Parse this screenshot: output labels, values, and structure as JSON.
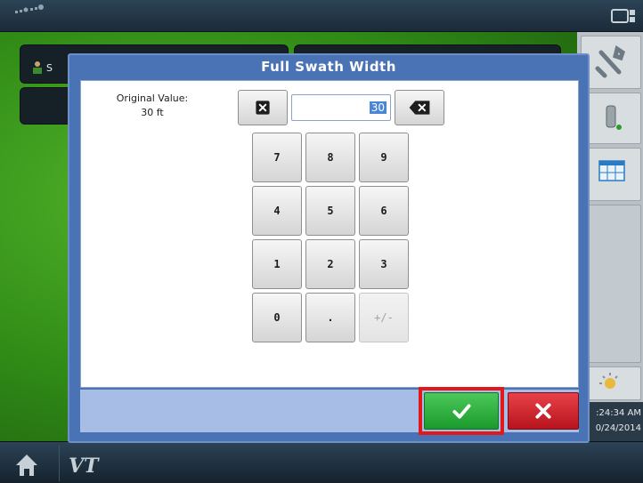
{
  "dialog": {
    "title": "Full Swath Width",
    "original_label": "Original Value:",
    "original_value": "30 ft",
    "input_value": "30",
    "keypad": [
      {
        "label": "7",
        "enabled": true
      },
      {
        "label": "8",
        "enabled": true
      },
      {
        "label": "9",
        "enabled": true
      },
      {
        "label": "4",
        "enabled": true
      },
      {
        "label": "5",
        "enabled": true
      },
      {
        "label": "6",
        "enabled": true
      },
      {
        "label": "1",
        "enabled": true
      },
      {
        "label": "2",
        "enabled": true
      },
      {
        "label": "3",
        "enabled": true
      },
      {
        "label": "0",
        "enabled": true
      },
      {
        "label": ".",
        "enabled": true
      },
      {
        "label": "+/-",
        "enabled": false
      }
    ]
  },
  "background": {
    "operator_label": "S"
  },
  "status": {
    "time": ":24:34 AM",
    "date": "0/24/2014"
  },
  "bottom": {
    "vt_label": "VT"
  },
  "colors": {
    "accept": "#2bb33e",
    "cancel": "#d3222c",
    "highlight": "#e2191b",
    "dialog": "#4a73b5"
  },
  "icons": [
    "gps-icon",
    "screen-icon",
    "wrench-icon",
    "implement-icon",
    "grid-table-icon",
    "sun-icon",
    "home-icon",
    "vt-icon",
    "checkmark-icon",
    "close-icon",
    "clear-icon",
    "backspace-icon",
    "operator-icon"
  ]
}
